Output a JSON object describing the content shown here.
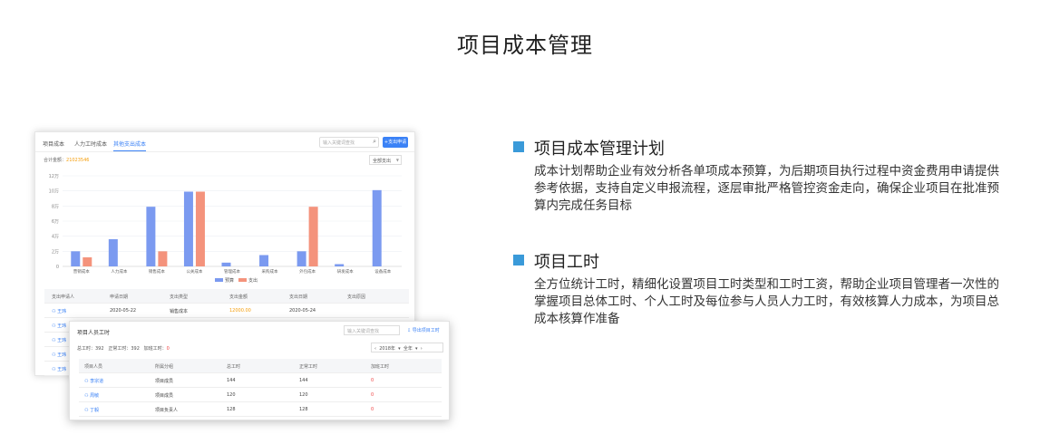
{
  "page_title": "项目成本管理",
  "main_card": {
    "tabs": [
      "项目成本",
      "人力工时成本",
      "其他支出成本"
    ],
    "search_placeholder": "输入关键词查找",
    "add_button": "+支出申请",
    "total_label": "合计金额：",
    "total_value": "21023546",
    "dropdown": "全部支出",
    "table": {
      "headers": [
        "支出申请人",
        "申请日期",
        "支出类型",
        "支出金额",
        "支出日期",
        "支出原因"
      ],
      "rows": [
        {
          "applicant": "王玮",
          "date": "2020-05-22",
          "type": "销售成本",
          "amount": "12000.00",
          "pay_date": "2020-05-24",
          "reason": ""
        },
        {
          "applicant": "王玮",
          "date": "",
          "type": "",
          "amount": "",
          "pay_date": "",
          "reason": ""
        },
        {
          "applicant": "王玮",
          "date": "",
          "type": "",
          "amount": "",
          "pay_date": "",
          "reason": ""
        },
        {
          "applicant": "王玮",
          "date": "",
          "type": "",
          "amount": "",
          "pay_date": "",
          "reason": ""
        },
        {
          "applicant": "王玮",
          "date": "",
          "type": "",
          "amount": "",
          "pay_date": "",
          "reason": ""
        }
      ]
    }
  },
  "chart_data": {
    "type": "bar",
    "categories": [
      "营销成本",
      "人力成本",
      "销售成本",
      "公关成本",
      "管理成本",
      "采购成本",
      "外包成本",
      "研发成本",
      "设备成本"
    ],
    "series": [
      {
        "name": "预算",
        "values": [
          2,
          3.6,
          7.9,
          9.9,
          0.5,
          1.5,
          2,
          0.3,
          10.1
        ],
        "color": "#7b9af0"
      },
      {
        "name": "支出",
        "values": [
          1.2,
          0,
          2,
          9.9,
          0,
          0,
          7.9,
          0,
          0
        ],
        "color": "#f4937c"
      }
    ],
    "ylim": [
      0,
      12
    ],
    "yticks": [
      "0",
      "2万",
      "4万",
      "6万",
      "8万",
      "10万",
      "12万"
    ],
    "grid": true,
    "legend": "bottom"
  },
  "overlay_card": {
    "title": "项目人员工时",
    "search_placeholder": "输入关键词查找",
    "export_label": "导出项目工时",
    "summary": {
      "total": "总工时：392",
      "normal": "正常工时：392",
      "overtime_label": "加班工时：",
      "overtime_value": "0"
    },
    "pager": {
      "year": "2018年",
      "scope": "全年"
    },
    "headers": [
      "项目人员",
      "所属分组",
      "总工时",
      "正常工时",
      "加班工时"
    ],
    "rows": [
      {
        "name": "李宗道",
        "group": "项目成员",
        "total": "144",
        "normal": "144",
        "overtime": "0"
      },
      {
        "name": "周敏",
        "group": "项目成员",
        "total": "120",
        "normal": "120",
        "overtime": "0"
      },
      {
        "name": "丁毅",
        "group": "项目负责人",
        "total": "128",
        "normal": "128",
        "overtime": "0"
      }
    ]
  },
  "features": [
    {
      "title": "项目成本管理计划",
      "desc": "成本计划帮助企业有效分析各单项成本预算，为后期项目执行过程中资金费用申请提供参考依据，支持自定义申报流程，逐层审批严格管控资金走向，确保企业项目在批准预算内完成任务目标"
    },
    {
      "title": "项目工时",
      "desc": "全方位统计工时，精细化设置项目工时类型和工时工资，帮助企业项目管理者一次性的掌握项目总体工时、个人工时及每位参与人员人力工时，有效核算人力成本，为项目总成本核算作准备"
    }
  ]
}
